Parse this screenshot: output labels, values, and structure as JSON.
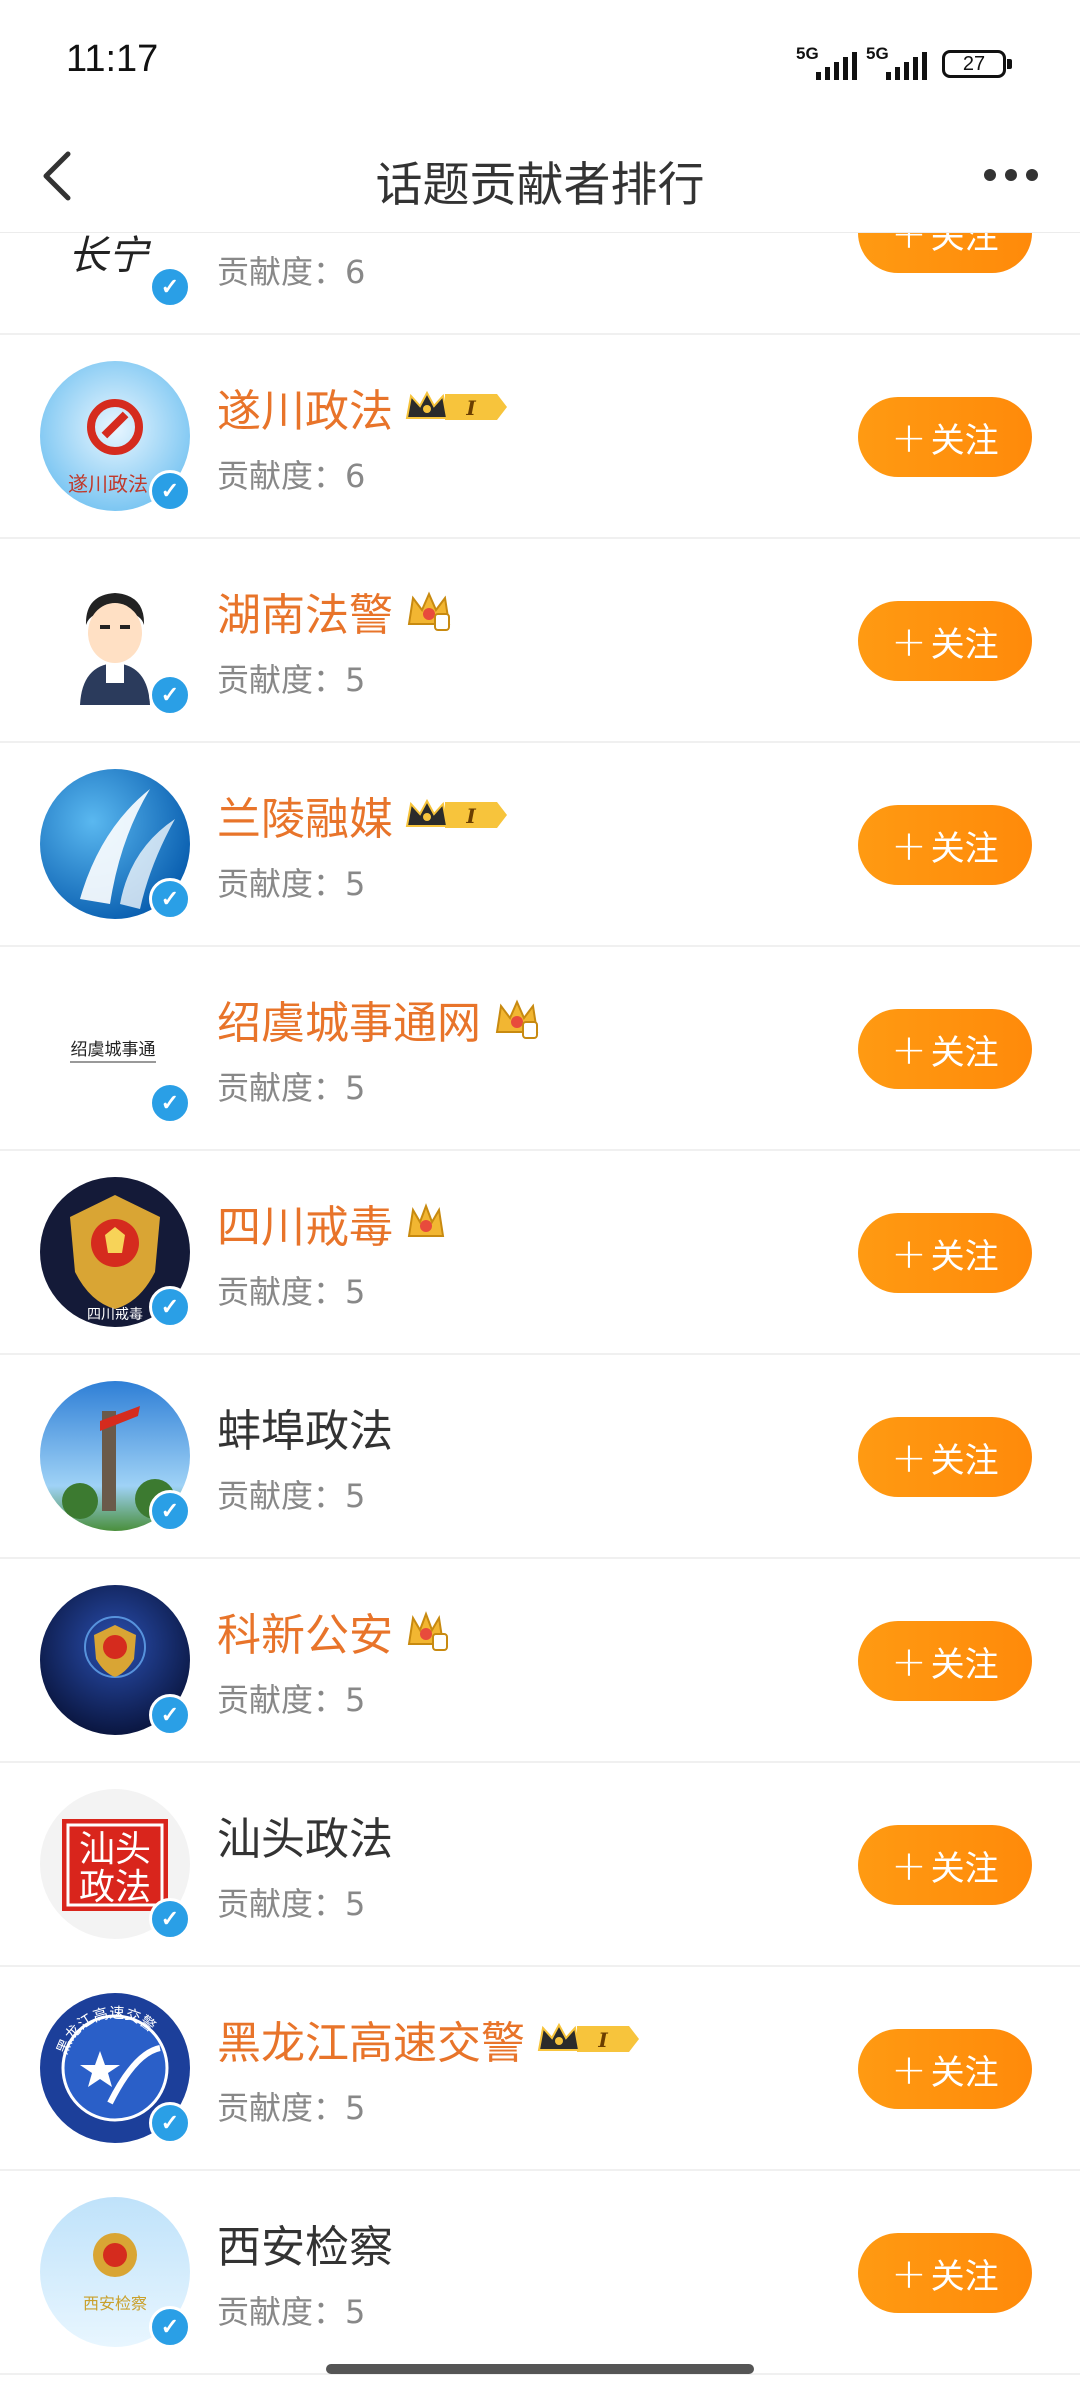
{
  "status_bar": {
    "time": "11:17",
    "network1": "5G",
    "network2": "5G",
    "battery": "27"
  },
  "nav": {
    "title": "话题贡献者排行",
    "back_icon": "chevron-left-icon",
    "more_icon": "more-dots-icon"
  },
  "score_label": "贡献度：",
  "follow_label": "关注",
  "colors": {
    "orange_name": "#e8742a",
    "follow_button": "#ff9210",
    "verified": "#2a9fe6"
  },
  "contributors": [
    {
      "name": "长宁",
      "score": "6",
      "highlight": false,
      "badge": ""
    },
    {
      "name": "遂川政法",
      "score": "6",
      "highlight": true,
      "badge": "crown-level-icon"
    },
    {
      "name": "湖南法警",
      "score": "5",
      "highlight": true,
      "badge": "crown-gold-icon"
    },
    {
      "name": "兰陵融媒",
      "score": "5",
      "highlight": true,
      "badge": "crown-level-icon"
    },
    {
      "name": "绍虞城事通网",
      "score": "5",
      "highlight": true,
      "badge": "crown-gold-icon"
    },
    {
      "name": "四川戒毒",
      "score": "5",
      "highlight": true,
      "badge": "crown-gold-icon"
    },
    {
      "name": "蚌埠政法",
      "score": "5",
      "highlight": false,
      "badge": ""
    },
    {
      "name": "科新公安",
      "score": "5",
      "highlight": true,
      "badge": "crown-gold-icon"
    },
    {
      "name": "汕头政法",
      "score": "5",
      "highlight": false,
      "badge": ""
    },
    {
      "name": "黑龙江高速交警",
      "score": "5",
      "highlight": true,
      "badge": "crown-level-icon"
    },
    {
      "name": "西安检察",
      "score": "5",
      "highlight": false,
      "badge": ""
    }
  ],
  "avatar_texts": {
    "changning": "长宁",
    "suichuan": "遂川政法",
    "shaoyu": "绍虞城事通",
    "sichuan": "四川戒毒",
    "shantou_1": "汕头",
    "shantou_2": "政法",
    "heilongjiang_ring": "黑龙江高速交警",
    "xian": "西安检察"
  }
}
